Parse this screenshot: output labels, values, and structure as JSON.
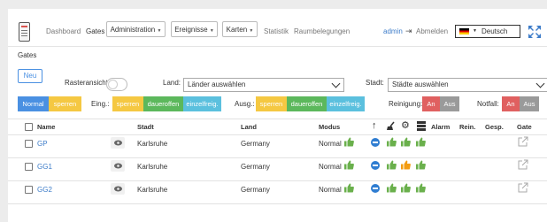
{
  "navbar": {
    "dashboard": "Dashboard",
    "gates": "Gates",
    "administration": "Administration",
    "ereignisse": "Ereignisse",
    "karten": "Karten",
    "statistik": "Statistik",
    "raumbelegungen": "Raumbelegungen",
    "user": "admin",
    "logout": "Abmelden",
    "language": "Deutsch"
  },
  "page_title": "Gates",
  "toolbar": {
    "new_button": "Neu",
    "raster_label": "Rasteransicht",
    "land_label": "Land:",
    "land_value": "Länder auswählen",
    "stadt_label": "Stadt:",
    "stadt_value": "Städte auswählen"
  },
  "filters": {
    "normal": "Normal",
    "sperren": "sperren",
    "eing_label": "Eing.:",
    "eing": [
      "sperren",
      "daueroffen",
      "einzelfreig."
    ],
    "ausg_label": "Ausg.:",
    "ausg": [
      "sperren",
      "daueroffen",
      "einzelfreig."
    ],
    "reinigung_label": "Reinigung:",
    "notfall_label": "Notfall:",
    "an": "An",
    "aus": "Aus"
  },
  "table": {
    "headers": {
      "name": "Name",
      "stadt": "Stadt",
      "land": "Land",
      "modus": "Modus",
      "alarm": "Alarm",
      "rein": "Rein.",
      "gesp": "Gesp.",
      "gate": "Gate"
    },
    "rows": [
      {
        "name": "GP",
        "stadt": "Karlsruhe",
        "land": "Germany",
        "modus": "Normal"
      },
      {
        "name": "GG1",
        "stadt": "Karlsruhe",
        "land": "Germany",
        "modus": "Normal"
      },
      {
        "name": "GG2",
        "stadt": "Karlsruhe",
        "land": "Germany",
        "modus": "Normal"
      }
    ]
  },
  "colors": {
    "blue": "#4a90e2",
    "yellow": "#f5c842",
    "green": "#5cb85c",
    "teal": "#5bc0de",
    "red": "#e06060",
    "grey": "#9a9a9a",
    "thumb_green": "#6ab04c",
    "thumb_orange": "#f39c12"
  }
}
